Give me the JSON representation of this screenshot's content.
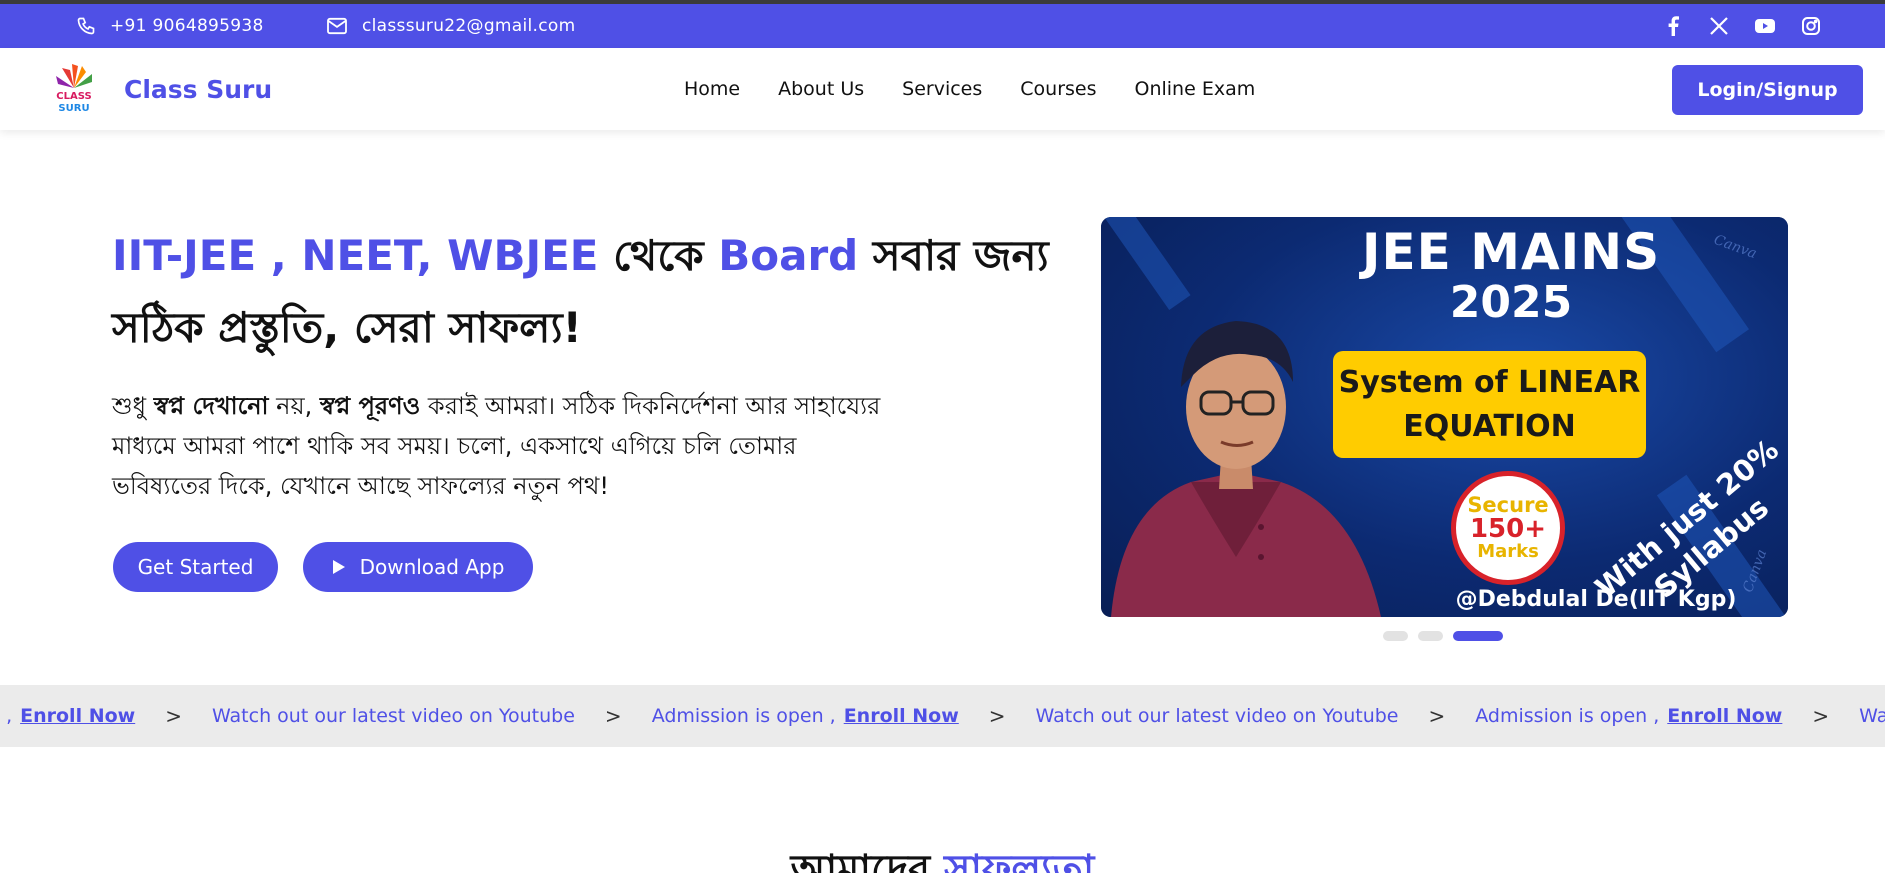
{
  "topbar": {
    "phone": "+91 9064895938",
    "email": "classsuru22@gmail.com",
    "social_icons": [
      "facebook-icon",
      "x-twitter-icon",
      "youtube-icon",
      "instagram-icon"
    ]
  },
  "navbar": {
    "brand": "Class Suru",
    "menu": [
      "Home",
      "About Us",
      "Services",
      "Courses",
      "Online Exam"
    ],
    "login_label": "Login/Signup"
  },
  "hero": {
    "title_accent_1": "IIT-JEE , NEET, WBJEE",
    "title_plain_1": " থেকে ",
    "title_accent_2": "Board",
    "title_plain_2": " সবার জন্য সঠিক প্রস্তুতি, সেরা সাফল্য!",
    "desc_1": "শুধু ",
    "desc_bold_1": "স্বপ্ন দেখানো",
    "desc_2": " নয়, ",
    "desc_bold_2": "স্বপ্ন পূরণও",
    "desc_3": " করাই আমরা। সঠিক দিকনির্দেশনা আর সাহায্যের মাধ্যমে আমরা পাশে থাকি সব সময়। চলো, একসাথে এগিয়ে চলি তোমার ভবিষ্যতের দিকে, যেখানে আছে সাফল্যের নতুন পথ!",
    "get_started_label": "Get Started",
    "download_label": "Download App"
  },
  "slider": {
    "title_line1": "JEE MAINS",
    "title_line2": "2025",
    "box_line1": "System of LINEAR",
    "box_line2": "EQUATION",
    "badge_line1": "Secure",
    "badge_line2": "150+",
    "badge_line3": "Marks",
    "syllabus_line1": "With just 20%",
    "syllabus_line2": "Syllabus",
    "credit": "@Debdulal De(IIT Kgp)",
    "watermark": "Canva",
    "dot_count": 3,
    "active_dot": 3
  },
  "ticker": {
    "first_link": "Enroll Now",
    "first_prefix": "n ,",
    "items": [
      {
        "text": "Watch out our latest video on Youtube",
        "link": ""
      },
      {
        "text": "Admission is open ,",
        "link": "Enroll Now"
      },
      {
        "text": "Watch out our latest video on Youtube",
        "link": ""
      },
      {
        "text": "Admission is open ,",
        "link": "Enroll Now"
      },
      {
        "text": "Watch out our latest video on Youtube",
        "link": ""
      }
    ],
    "separator": ">"
  },
  "section": {
    "title_plain": "আমাদের ",
    "title_accent": "সাফল্যতা"
  },
  "colors": {
    "accent": "#4f50e6",
    "ticker_bg": "#ebebeb",
    "slide_box": "#ffcc00"
  }
}
